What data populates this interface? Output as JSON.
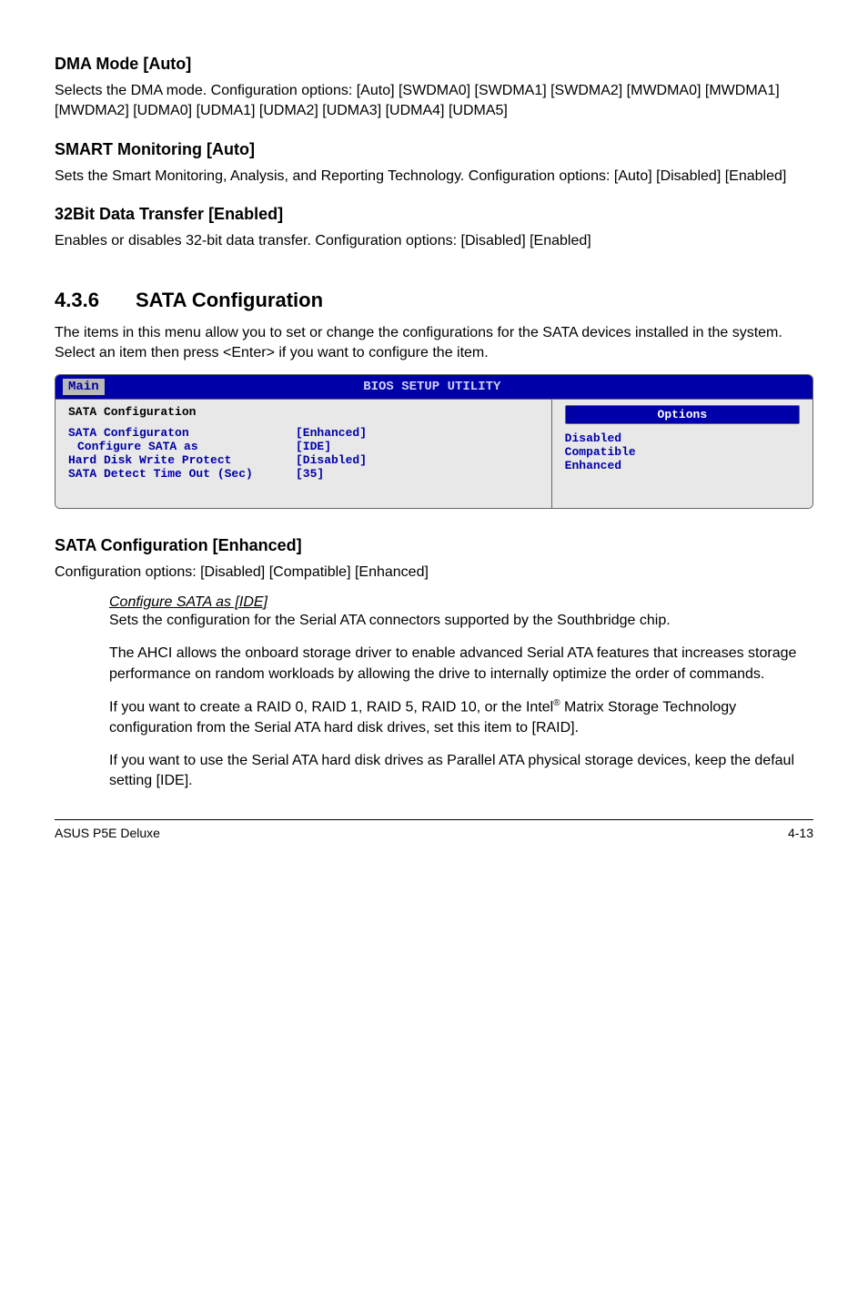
{
  "sections": {
    "dma": {
      "heading": "DMA Mode [Auto]",
      "text": "Selects the DMA mode. Configuration options: [Auto] [SWDMA0] [SWDMA1] [SWDMA2] [MWDMA0] [MWDMA1] [MWDMA2] [UDMA0] [UDMA1] [UDMA2] [UDMA3] [UDMA4] [UDMA5]"
    },
    "smart": {
      "heading": "SMART Monitoring [Auto]",
      "text": "Sets the Smart Monitoring, Analysis, and Reporting Technology. Configuration options: [Auto] [Disabled] [Enabled]"
    },
    "bit32": {
      "heading": "32Bit Data Transfer [Enabled]",
      "text": "Enables or disables 32-bit data transfer. Configuration options: [Disabled] [Enabled]"
    }
  },
  "majorSection": {
    "number": "4.3.6",
    "title": "SATA Configuration",
    "intro": "The items in this menu allow you to set or change the configurations for the SATA devices installed in the system. Select an item then press <Enter> if you want to configure the item."
  },
  "bios": {
    "titlebar": {
      "tab": "Main",
      "title": "BIOS SETUP UTILITY"
    },
    "left_title": "SATA Configuration",
    "rows": [
      {
        "label": "SATA Configuraton",
        "value": "[Enhanced]",
        "indent": false
      },
      {
        "label": "Configure SATA as",
        "value": "[IDE]",
        "indent": true
      },
      {
        "label": "",
        "value": "",
        "indent": false
      },
      {
        "label": "Hard Disk Write Protect",
        "value": "[Disabled]",
        "indent": false
      },
      {
        "label": "SATA Detect Time Out (Sec)",
        "value": "[35]",
        "indent": false
      }
    ],
    "options_label": "Options",
    "options": [
      "Disabled",
      "Compatible",
      "Enhanced"
    ]
  },
  "sataConf": {
    "heading": "SATA Configuration [Enhanced]",
    "text": "Configuration options: [Disabled] [Compatible] [Enhanced]",
    "sub_heading": "Configure SATA as [IDE]",
    "p1": "Sets the configuration for the Serial ATA connectors supported by the Southbridge chip.",
    "p2": "The AHCI allows the onboard storage driver to enable advanced Serial ATA features that increases storage performance on random workloads by allowing the drive to internally optimize the order of commands.",
    "p3_pre": "If you want to create a RAID 0, RAID 1,  RAID 5,  RAID 10, or the Intel",
    "p3_sup": "®",
    "p3_post": " Matrix Storage Technology configuration from the Serial ATA hard disk drives, set this item to [RAID].",
    "p4": "If you want to use the Serial ATA hard disk drives as Parallel ATA physical storage devices, keep the defaul setting [IDE]."
  },
  "footer": {
    "left": "ASUS P5E Deluxe",
    "right": "4-13"
  }
}
